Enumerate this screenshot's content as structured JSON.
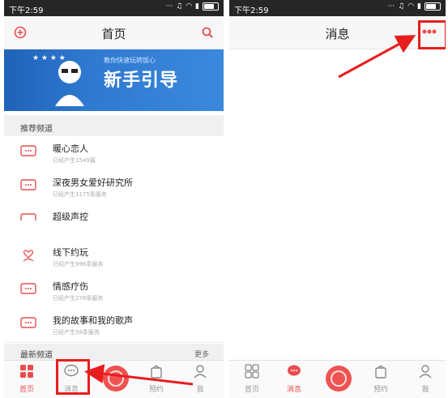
{
  "left": {
    "status": {
      "time": "下午2:59"
    },
    "header": {
      "title": "首页",
      "left_icon": "add-circle-icon",
      "right_icon": "search-icon"
    },
    "banner": {
      "small_text": "教你快速玩转饭心",
      "big_text": "新手引导"
    },
    "section_recommend": {
      "label": "推荐频道"
    },
    "channels": [
      {
        "title": "暖心恋人",
        "sub": "已经产生1549篇"
      },
      {
        "title": "深夜男女爱好研究所",
        "sub": "已经产生1175条服务"
      },
      {
        "title": "超级声控",
        "sub": ""
      },
      {
        "title": "线下约玩",
        "sub": "已经产生996条服务"
      },
      {
        "title": "情感疗伤",
        "sub": "已经产生278条服务"
      },
      {
        "title": "我的故事和我的歌声",
        "sub": "已经产生58条服务"
      }
    ],
    "section_new": {
      "label": "最新频道",
      "more": "更多"
    },
    "tabs": [
      {
        "label": "首页"
      },
      {
        "label": "消息"
      },
      {
        "label": "预约"
      },
      {
        "label": "我"
      }
    ]
  },
  "right": {
    "status": {
      "time": "下午2:59"
    },
    "header": {
      "title": "消息",
      "right_icon": "more-dots-icon"
    },
    "tabs": [
      {
        "label": "首页"
      },
      {
        "label": "消息"
      },
      {
        "label": "预约"
      },
      {
        "label": "我"
      }
    ]
  },
  "colors": {
    "accent": "#e94e4e",
    "highlight": "#e81e1e",
    "banner": "#2f7ad1"
  }
}
